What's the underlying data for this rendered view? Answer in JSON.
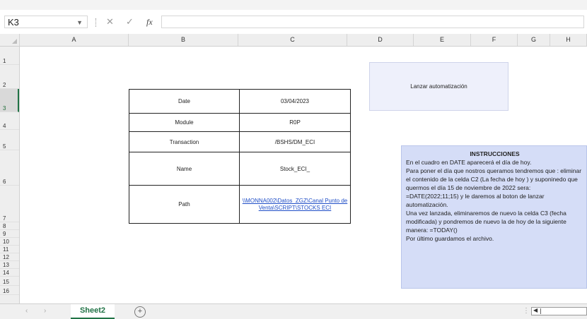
{
  "formula_bar": {
    "name_box": "K3",
    "cancel_symbol": "✕",
    "enter_symbol": "✓",
    "fx_label": "fx",
    "formula": ""
  },
  "columns": [
    "A",
    "B",
    "C",
    "D",
    "E",
    "F",
    "G",
    "H"
  ],
  "rows": [
    "1",
    "2",
    "3",
    "4",
    "5",
    "6",
    "7",
    "8",
    "9",
    "10",
    "11",
    "12",
    "13",
    "14",
    "15",
    "16"
  ],
  "selected_row": "3",
  "table": {
    "rows": [
      {
        "label": "Date",
        "value": "03/04/2023"
      },
      {
        "label": "Module",
        "value": "R0P"
      },
      {
        "label": "Transaction",
        "value": "/BSHS/DM_ECI"
      },
      {
        "label": "Name",
        "value": "Stock_ECI_"
      },
      {
        "label": "Path",
        "value": "\\\\MONNA002\\Datos_ZGZ\\Canal Punto de Venta\\SCRIPT\\STOCKS ECI"
      }
    ]
  },
  "launch_button": {
    "label": "Lanzar automatización"
  },
  "instructions": {
    "title": "INSTRUCCIONES",
    "lines": [
      "En el cuadro en DATE aparecerá el día de hoy.",
      "Para poner el día que nostros queramos tendremos que : eliminar el contenido de la celda C2 (La fecha de hoy ) y suponinedo que quermos el día 15 de noviembre de 2022 sera:",
      "=DATE(2022;11;15) y le daremos al boton de lanzar automatización.",
      "Una vez lanzada, eliminaremos de nuevo la celda C3 (fecha modificada) y pondremos de nuevo la de hoy de la siguiente manera: =TODAY()",
      "Por último guardamos el archivo."
    ]
  },
  "sheet_tabs": {
    "active": "Sheet2",
    "add_symbol": "+"
  },
  "icons": {
    "name_box_dropdown": "chevron-down-icon",
    "add_sheet": "plus-circle-icon",
    "scroll_left": "caret-left-icon"
  },
  "colors": {
    "accent": "#217346",
    "instructions_bg": "#d5ddf7",
    "button_bg": "#eef0fb",
    "link": "#1f4ec7"
  }
}
